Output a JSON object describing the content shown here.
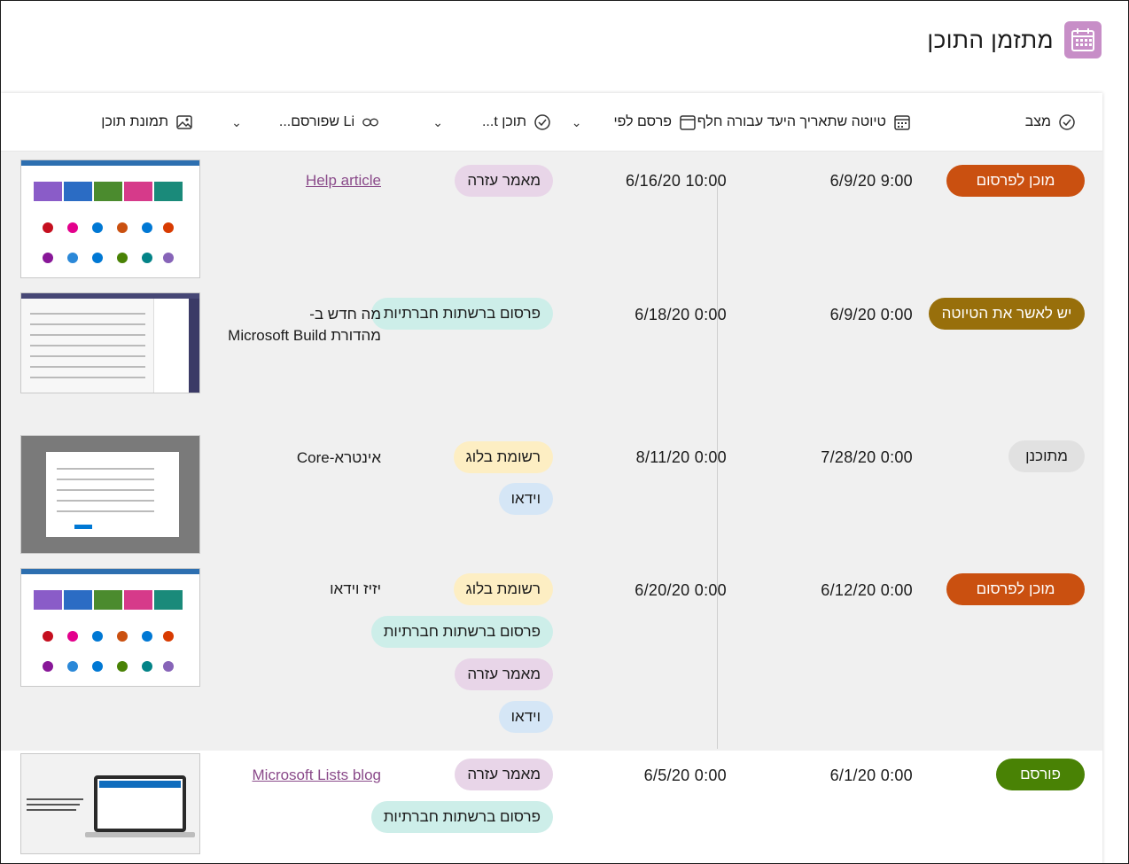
{
  "app": {
    "title": "מתזמן התוכן",
    "icon": "calendar-icon",
    "accent": "#c78ec7"
  },
  "columns": [
    {
      "id": "status",
      "label": "מצב",
      "icon": "status-circle-icon"
    },
    {
      "id": "draft_due",
      "label": "טיוטה שתאריך היעד עבורה חלף",
      "icon": "calendar-icon"
    },
    {
      "id": "publish_by",
      "label": "פרסם לפי",
      "icon": "calendar-icon"
    },
    {
      "id": "content_type",
      "label": "תוכן t...",
      "icon": "status-circle-icon"
    },
    {
      "id": "link",
      "label": "Li שפורסם...",
      "icon": "link-icon"
    },
    {
      "id": "image",
      "label": "תמונת תוכן",
      "icon": "image-icon"
    }
  ],
  "rows": [
    {
      "status": "מוכן לפרסום",
      "status_color": "#ca5010",
      "draft_due": "6/9/20 9:00",
      "publish_by": "6/16/20 10:00",
      "tags": [
        {
          "label": "מאמר עזרה",
          "color": "#e8d5e8"
        }
      ],
      "title": "Help article",
      "title_is_link": true
    },
    {
      "status": "יש לאשר את הטיוטה",
      "status_color": "#986f0b",
      "draft_due": "6/9/20 0:00",
      "publish_by": "6/18/20 0:00",
      "tags": [
        {
          "label": "פרסום ברשתות חברתיות",
          "color": "#cdeee9"
        }
      ],
      "title_lines": [
        "מה חדש ב-",
        "מהדורת Microsoft Build"
      ],
      "title_is_link": false
    },
    {
      "status": "מתוכנן",
      "status_color": "#e1e1e1",
      "draft_due": "7/28/20 0:00",
      "publish_by": "8/11/20 0:00",
      "tags": [
        {
          "label": "רשומת בלוג",
          "color": "#fdeec3"
        },
        {
          "label": "וידאו",
          "color": "#d5e6f6"
        }
      ],
      "title": "אינטרא-Core",
      "title_is_link": false
    },
    {
      "status": "מוכן לפרסום",
      "status_color": "#ca5010",
      "draft_due": "6/12/20 0:00",
      "publish_by": "6/20/20 0:00",
      "tags": [
        {
          "label": "רשומת בלוג",
          "color": "#fdeec3"
        },
        {
          "label": "פרסום ברשתות חברתיות",
          "color": "#cdeee9"
        },
        {
          "label": "מאמר עזרה",
          "color": "#e8d5e8"
        },
        {
          "label": "וידאו",
          "color": "#d5e6f6"
        }
      ],
      "title": "יזיז וידאו",
      "title_is_link": false
    },
    {
      "status": "פורסם",
      "status_color": "#498205",
      "draft_due": "6/1/20 0:00",
      "publish_by": "6/5/20 0:00",
      "tags": [
        {
          "label": "מאמר עזרה",
          "color": "#e8d5e8"
        },
        {
          "label": "פרסום ברשתות חברתיות",
          "color": "#cdeee9"
        }
      ],
      "title": "Microsoft Lists blog",
      "title_is_link": true
    }
  ]
}
